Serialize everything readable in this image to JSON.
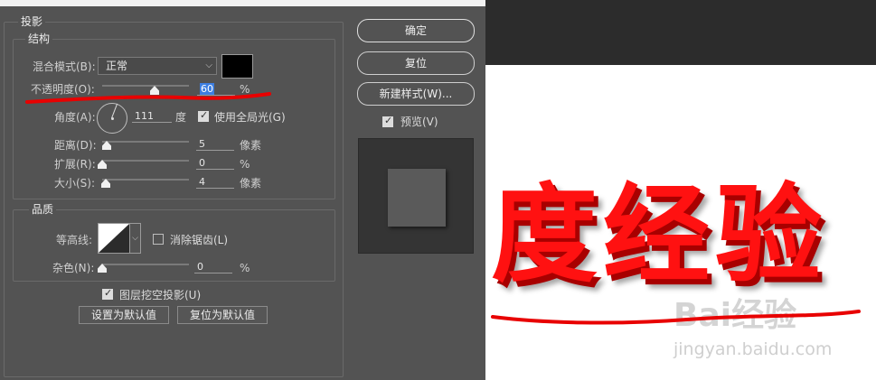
{
  "dialog": {
    "section_title": "投影",
    "structure": {
      "legend": "结构",
      "blend_mode_label": "混合模式(B):",
      "blend_mode_value": "正常",
      "blend_color": "#000000",
      "opacity_label": "不透明度(O):",
      "opacity_value": "60",
      "opacity_unit": "%",
      "angle_label": "角度(A):",
      "angle_value": "111",
      "angle_unit": "度",
      "global_light_label": "使用全局光(G)",
      "global_light_checked": true,
      "distance_label": "距离(D):",
      "distance_value": "5",
      "distance_unit": "像素",
      "spread_label": "扩展(R):",
      "spread_value": "0",
      "spread_unit": "%",
      "size_label": "大小(S):",
      "size_value": "4",
      "size_unit": "像素"
    },
    "quality": {
      "legend": "品质",
      "contour_label": "等高线:",
      "anti_alias_label": "消除锯齿(L)",
      "anti_alias_checked": false,
      "noise_label": "杂色(N):",
      "noise_value": "0",
      "noise_unit": "%"
    },
    "knockout_label": "图层挖空投影(U)",
    "knockout_checked": true,
    "make_default_label": "设置为默认值",
    "reset_default_label": "复位为默认值",
    "ok_label": "确定",
    "reset_label": "复位",
    "new_style_label": "新建样式(W)...",
    "preview_label": "预览(V)",
    "preview_checked": true
  },
  "canvas": {
    "big_text": "度经验",
    "big_text_color": "#ff1111",
    "watermark_main": "Bai经验",
    "watermark_url": "jingyan.baidu.com",
    "annotation_color": "#e80000"
  }
}
